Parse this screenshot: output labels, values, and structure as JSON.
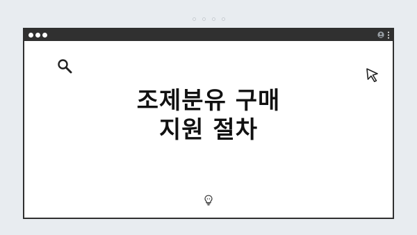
{
  "page": {
    "headline_line1": "조제분유 구매",
    "headline_line2": "지원 절차"
  },
  "icons": {
    "search": "search-icon",
    "cursor": "cursor-arrow-icon",
    "lightbulb": "lightbulb-icon",
    "user": "user-icon",
    "menu": "kebab-menu-icon"
  },
  "colors": {
    "background": "#e8ecf0",
    "titlebar": "#303030",
    "frame_border": "#2f2f2f",
    "canvas": "#ffffff",
    "text": "#111111"
  }
}
